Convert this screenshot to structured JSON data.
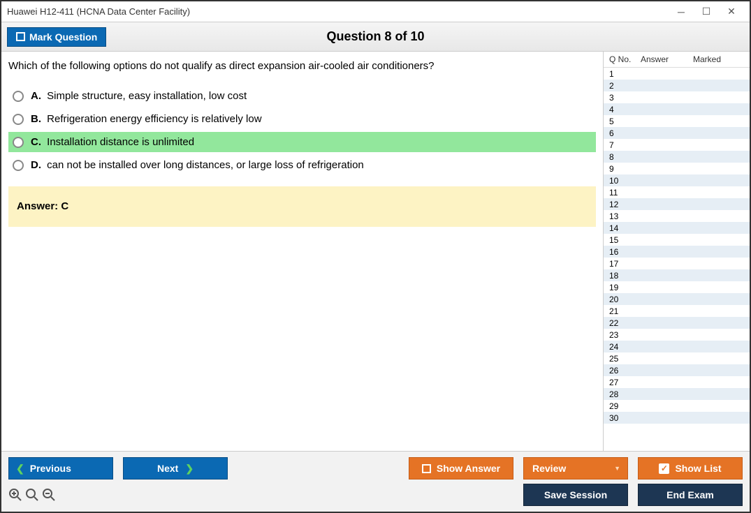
{
  "titlebar": {
    "title": "Huawei H12-411 (HCNA Data Center Facility)"
  },
  "header": {
    "mark_label": "Mark Question",
    "question_title": "Question 8 of 10"
  },
  "question": {
    "text": "Which of the following options do not qualify as direct expansion air-cooled air conditioners?",
    "options": [
      {
        "letter": "A.",
        "text": "Simple structure, easy installation, low cost",
        "correct": false
      },
      {
        "letter": "B.",
        "text": "Refrigeration energy efficiency is relatively low",
        "correct": false
      },
      {
        "letter": "C.",
        "text": "Installation distance is unlimited",
        "correct": true
      },
      {
        "letter": "D.",
        "text": "can not be installed over long distances, or large loss of refrigeration",
        "correct": false
      }
    ],
    "answer_label": "Answer: C"
  },
  "sidebar": {
    "headers": {
      "qno": "Q No.",
      "answer": "Answer",
      "marked": "Marked"
    },
    "max": 30
  },
  "footer": {
    "previous": "Previous",
    "next": "Next",
    "show_answer": "Show Answer",
    "review": "Review",
    "show_list": "Show List",
    "save_session": "Save Session",
    "end_exam": "End Exam"
  }
}
